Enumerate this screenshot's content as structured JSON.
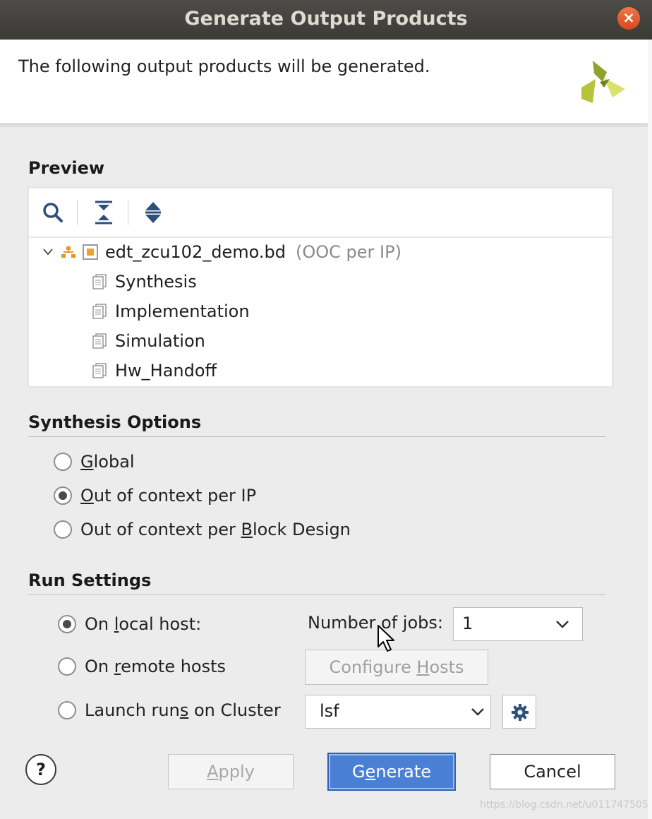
{
  "window": {
    "title": "Generate Output Products"
  },
  "header": {
    "text": "The following output products will be generated."
  },
  "preview": {
    "title": "Preview",
    "root": {
      "label": "edt_zcu102_demo.bd",
      "note": "(OOC per IP)"
    },
    "children": [
      "Synthesis",
      "Implementation",
      "Simulation",
      "Hw_Handoff"
    ]
  },
  "synthesis_options": {
    "title": "Synthesis Options",
    "options": [
      {
        "pre": "",
        "key": "G",
        "post": "lobal",
        "selected": false
      },
      {
        "pre": "",
        "key": "O",
        "post": "ut of context per IP",
        "selected": true
      },
      {
        "pre": "Out of context per ",
        "key": "B",
        "post": "lock Design",
        "selected": false
      }
    ]
  },
  "run_settings": {
    "title": "Run Settings",
    "local": {
      "pre": "On ",
      "key": "l",
      "post": "ocal host:",
      "selected": true
    },
    "remote": {
      "pre": "On ",
      "key": "r",
      "post": "emote hosts",
      "selected": false
    },
    "cluster": {
      "pre": "Launch run",
      "key": "s",
      "post": " on Cluster",
      "selected": false
    },
    "jobs_label": "Number of jobs:",
    "jobs_value": "1",
    "configure": {
      "pre": "Configure ",
      "key": "H",
      "post": "osts"
    },
    "cluster_value": "lsf"
  },
  "buttons": {
    "help": "?",
    "apply": {
      "pre": "",
      "key": "A",
      "post": "pply"
    },
    "generate": {
      "pre": "G",
      "key": "e",
      "post": "nerate"
    },
    "cancel": "Cancel"
  },
  "watermark": "https://blog.csdn.net/u011747505",
  "colors": {
    "accent": "#4a7fd6",
    "logo": "#c6d52c"
  }
}
